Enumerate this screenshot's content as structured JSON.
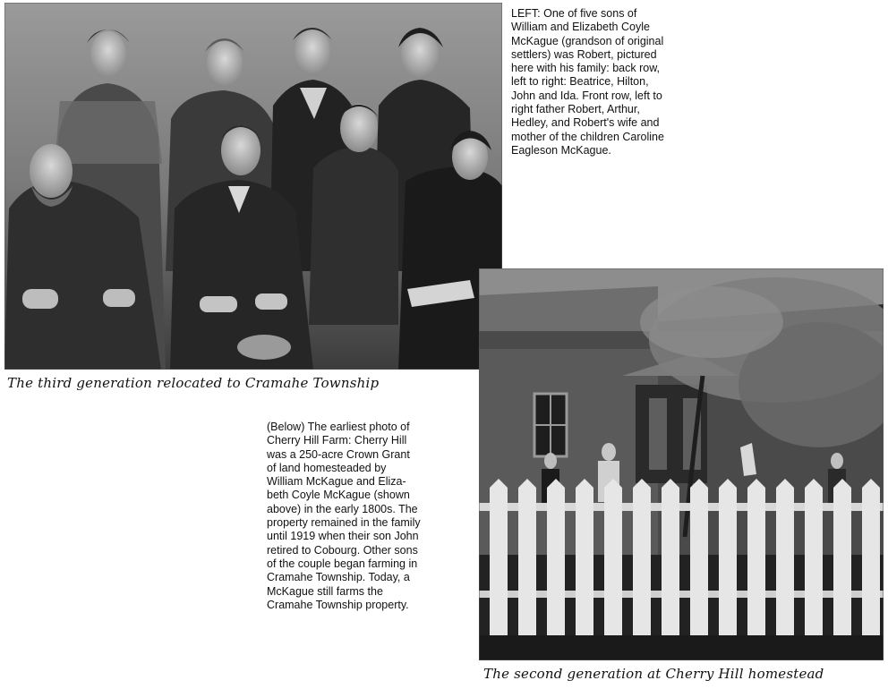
{
  "family_photo": {
    "caption_title": "The third generation relocated to Cramahe Township"
  },
  "left_caption": {
    "lines": [
      "LEFT: One of five sons of",
      "William and Elizabeth Coyle",
      "McKague (grandson of original",
      "settlers) was Robert, pictured",
      "here with his family: back row,",
      "left to right: Beatrice, Hilton,",
      "John and Ida. Front row, left to",
      "right father Robert, Arthur,",
      "Hedley, and Robert's wife and",
      "mother of the children Caroline",
      "Eagleson McKague."
    ]
  },
  "below_caption": {
    "lines": [
      "(Below) The earliest photo of",
      "Cherry Hill Farm: Cherry Hill",
      "was a 250-acre Crown Grant",
      "of land homesteaded by",
      "William McKague and Eliza-",
      "beth Coyle McKague (shown",
      "above) in the early 1800s. The",
      "property remained in the family",
      "until 1919 when their son John",
      "retired to Cobourg. Other sons",
      "of the couple began farming in",
      "Cramahe Township. Today, a",
      "McKague still farms the",
      "Cramahe Township property."
    ]
  },
  "farm_photo": {
    "caption_title": "The second generation at Cherry Hill homestead"
  }
}
